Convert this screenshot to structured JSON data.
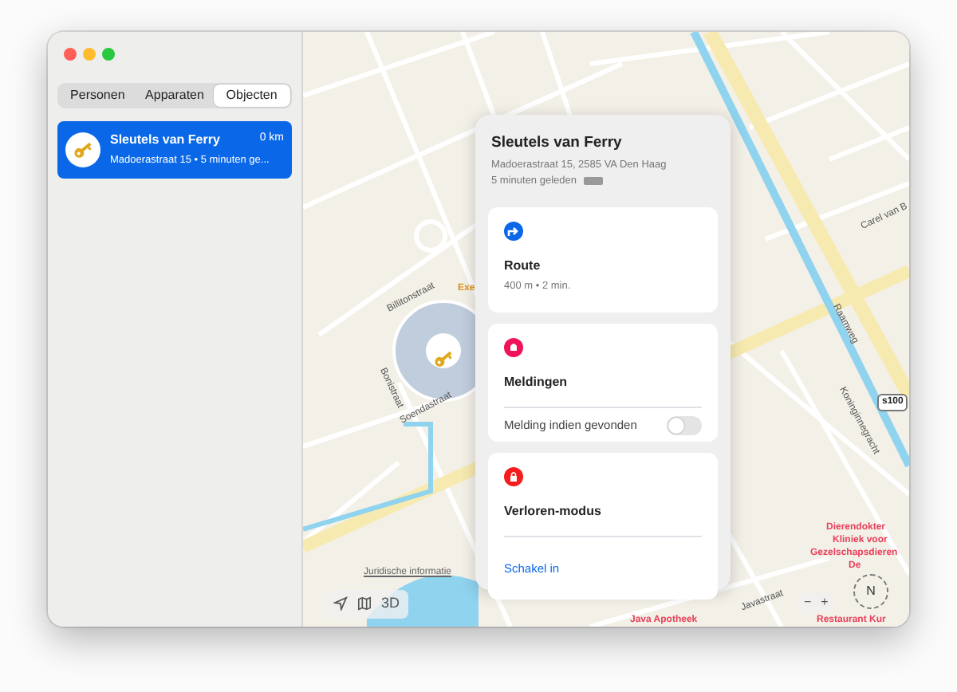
{
  "tabs": [
    {
      "label": "Personen",
      "selected": false
    },
    {
      "label": "Apparaten",
      "selected": false
    },
    {
      "label": "Objecten",
      "selected": true
    }
  ],
  "items": [
    {
      "name": "Sleutels van Ferry",
      "subtitle": "Madoerastraat 15 • 5 minuten ge...",
      "distance": "0 km",
      "selected": true
    }
  ],
  "map": {
    "labels": [
      {
        "kind": "street",
        "text": "Billitonstraat"
      },
      {
        "kind": "street",
        "text": "Soendastraat"
      },
      {
        "kind": "street",
        "text": "Bonistraat"
      },
      {
        "kind": "street",
        "text": "Raamweg"
      },
      {
        "kind": "street",
        "text": "Carel van B"
      },
      {
        "kind": "street",
        "text": "Koninginnegracht"
      },
      {
        "kind": "street",
        "text": "Javastraat"
      },
      {
        "kind": "poi",
        "text": "Exe"
      },
      {
        "kind": "poi",
        "text": "Dierendokter"
      },
      {
        "kind": "poi",
        "text": "Kliniek voor"
      },
      {
        "kind": "poi",
        "text": "Gezelschapsdieren"
      },
      {
        "kind": "poi",
        "text": "De"
      },
      {
        "kind": "poi",
        "text": "Java Apotheek"
      },
      {
        "kind": "poi",
        "text": "Restaurant Kur"
      }
    ],
    "road_badge": "s100",
    "legal": "Juridische informatie",
    "view_3d": "3D",
    "zoom_out": "−",
    "zoom_in": "+",
    "compass": "N"
  },
  "panel": {
    "title": "Sleutels van Ferry",
    "address": "Madoerastraat 15, 2585 VA Den Haag",
    "time": "5 minuten geleden",
    "sections": [
      {
        "kind": "route",
        "title": "Route",
        "detail": "400 m • 2 min."
      },
      {
        "kind": "notify",
        "title": "Meldingen",
        "toggle_label": "Melding indien gevonden",
        "on": false
      },
      {
        "kind": "lost",
        "title": "Verloren-modus",
        "action": "Schakel in"
      }
    ]
  }
}
